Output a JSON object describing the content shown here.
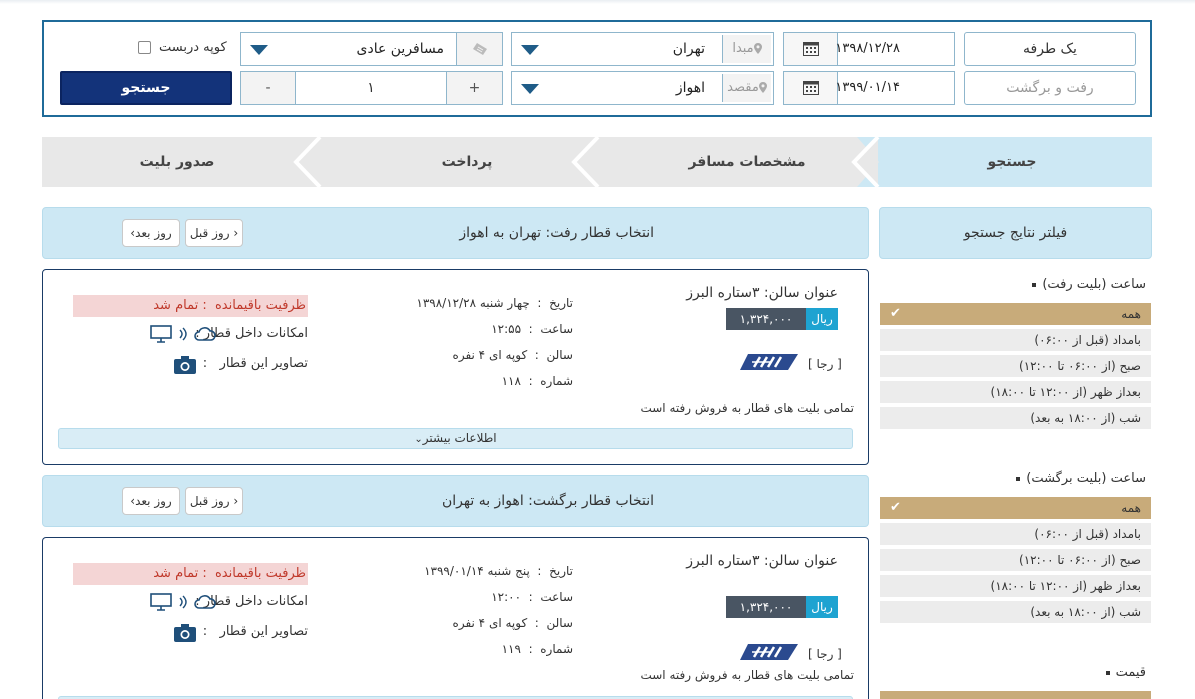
{
  "search": {
    "trip_one_way": "یک طرفه",
    "trip_round": "رفت و برگشت",
    "date_depart": "۱۳۹۸/۱۲/۲۸",
    "date_return": "۱۳۹۹/۰۱/۱۴",
    "origin_label": "مبدا",
    "origin_value": "تهران",
    "dest_label": "مقصد",
    "dest_value": "اهواز",
    "passenger_type": "مسافرین عادی",
    "coupe_label": "کوپه دربست",
    "count": "۱",
    "plus": "+",
    "minus": "-",
    "search_button": "جستجو"
  },
  "steps": [
    "جستجو",
    "مشخصات مسافر",
    "پرداخت",
    "صدور بلیت"
  ],
  "filter": {
    "title": "فیلتر نتایج جستجو",
    "sections": [
      {
        "title": "ساعت (بلیت رفت)",
        "rows": [
          "همه",
          "بامداد (قبل از ۰۶:۰۰)",
          "صبح (از ۰۶:۰۰ تا ۱۲:۰۰)",
          "بعداز ظهر (از ۱۲:۰۰ تا ۱۸:۰۰)",
          "شب (از ۱۸:۰۰ به بعد)"
        ]
      },
      {
        "title": "ساعت (بلیت برگشت)",
        "rows": [
          "همه",
          "بامداد (قبل از ۰۶:۰۰)",
          "صبح (از ۰۶:۰۰ تا ۱۲:۰۰)",
          "بعداز ظهر (از ۱۲:۰۰ تا ۱۸:۰۰)",
          "شب (از ۱۸:۰۰ به بعد)"
        ]
      },
      {
        "title": "قیمت"
      }
    ]
  },
  "day_prev": "روز قبل",
  "day_next": "روز بعد",
  "outbound": {
    "title": "انتخاب قطار رفت: تهران به اهواز",
    "card": {
      "salon_title": "عنوان سالن: ۳ستاره البرز",
      "price": "۱,۳۲۴,۰۰۰",
      "currency": "ریال",
      "company": "[ رجا ]",
      "sold_note": "تمامی بلیت های قطار به فروش رفته است",
      "date_label": "تاریخ",
      "date_value": "چهار شنبه ۱۳۹۸/۱۲/۲۸",
      "time_label": "ساعت",
      "time_value": "۱۲:۵۵",
      "salon_label": "سالن",
      "salon_value": "کوپه ای ۴ نفره",
      "number_label": "شماره",
      "number_value": "۱۱۸",
      "capacity_label": "ظرفیت باقیمانده",
      "capacity_value": ": تمام شد",
      "amenities_label": "امکانات داخل قطار :",
      "photos_label": "تصاویر این قطار",
      "colon": ":",
      "more_info": "اطلاعات بیشتر"
    }
  },
  "return": {
    "title": "انتخاب قطار برگشت: اهواز به تهران",
    "card": {
      "salon_title": "عنوان سالن: ۳ستاره البرز",
      "price": "۱,۳۲۴,۰۰۰",
      "currency": "ریال",
      "company": "[ رجا ]",
      "sold_note": "تمامی بلیت های قطار به فروش رفته است",
      "date_label": "تاریخ",
      "date_value": "پنج شنبه ۱۳۹۹/۰۱/۱۴",
      "time_label": "ساعت",
      "time_value": "۱۲:۰۰",
      "salon_label": "سالن",
      "salon_value": "کوپه ای ۴ نفره",
      "number_label": "شماره",
      "number_value": "۱۱۹",
      "capacity_label": "ظرفیت باقیمانده",
      "capacity_value": ": تمام شد",
      "amenities_label": "امکانات داخل قطار :",
      "photos_label": "تصاویر این قطار",
      "colon": ":"
    }
  },
  "colors": {
    "frame": "#1f6b99",
    "search_button": "#13337a",
    "light_blue": "#cde8f4",
    "gold": "#c8ab7a",
    "price_blue": "#1ea3d1",
    "price_dark": "#495563",
    "sold_red": "#c0392b"
  },
  "icons": [
    "calendar-icon",
    "location-pin-icon",
    "ticket-icon",
    "dropdown-arrow-icon",
    "check-icon",
    "tv-icon",
    "wifi-icon",
    "cloud-icon",
    "camera-icon",
    "raja-logo",
    "chevron-down-icon",
    "chevron-left-icon"
  ]
}
